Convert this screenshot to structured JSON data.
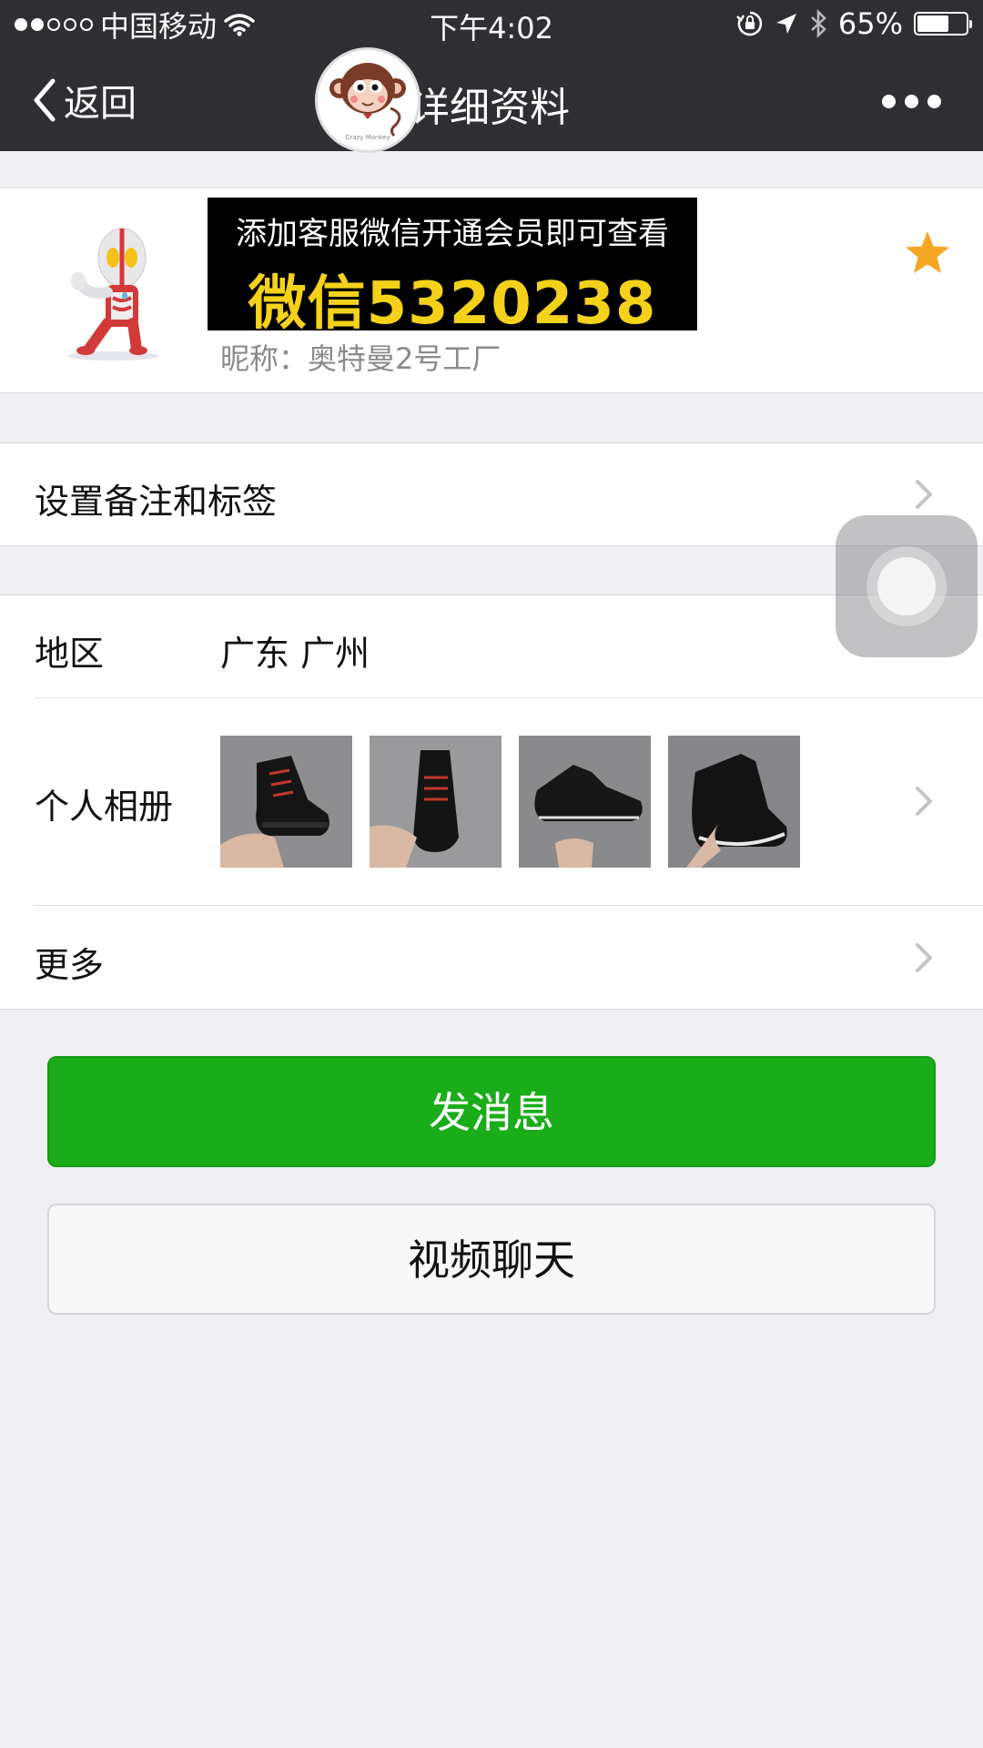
{
  "status_bar": {
    "carrier": "中国移动",
    "time": "下午4:02",
    "battery_percent": "65%",
    "battery_level": 0.65,
    "signal_bars_filled": 2,
    "signal_bars_total": 5,
    "icons": [
      "wifi-icon",
      "orientation-lock-icon",
      "location-arrow-icon",
      "bluetooth-icon",
      "battery-icon"
    ]
  },
  "nav": {
    "back_label": "返回",
    "title": "详细资料",
    "more_icon": "more-dots-icon"
  },
  "badge": {
    "text": "Crazy Monkey"
  },
  "profile": {
    "promo_line1": "添加客服微信开通会员即可查看",
    "promo_line2": "微信5320238",
    "nickname": "昵称：奥特曼2号工厂",
    "starred": true,
    "colors": {
      "star": "#f5a623",
      "promo_bg": "#000000",
      "promo_accent": "#f5d21a"
    }
  },
  "rows": {
    "remark": {
      "label": "设置备注和标签"
    },
    "region": {
      "label": "地区",
      "value": "广东 广州"
    },
    "album": {
      "label": "个人相册",
      "photo_count": 4
    },
    "more": {
      "label": "更多"
    }
  },
  "actions": {
    "send_message": "发消息",
    "video_chat": "视频聊天",
    "colors": {
      "primary": "#1aad19"
    }
  }
}
